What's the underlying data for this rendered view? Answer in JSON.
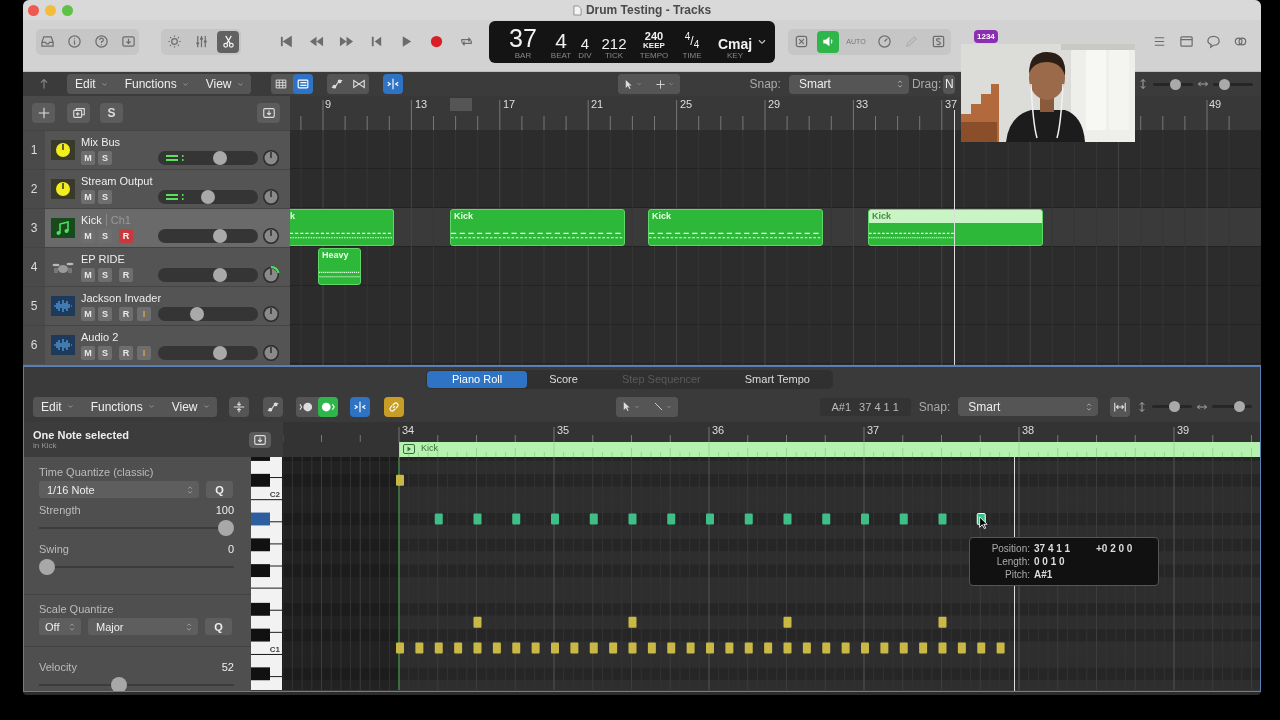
{
  "window": {
    "title": "Drum Testing - Tracks"
  },
  "control_bar": {
    "view_toggles": [
      {
        "on": false
      },
      {
        "on": false
      },
      {
        "on": true
      }
    ],
    "lcd": [
      {
        "value": "37",
        "label": "BAR"
      },
      {
        "value": "4",
        "label": "BEAT"
      },
      {
        "value": "4",
        "label": "DIV"
      },
      {
        "value": "212",
        "label": "TICK"
      },
      {
        "value": "240",
        "sub": "KEEP",
        "label": "TEMPO"
      },
      {
        "value": "$^{4}$/$_{4}$",
        "label": "TIME"
      },
      {
        "value": "Cmaj",
        "label": "KEY"
      }
    ],
    "monitor_toggles": [
      {
        "on": false
      },
      {
        "on": true
      }
    ],
    "auto_label": "AUTO",
    "badge": "1234"
  },
  "tracks_toolbar": {
    "menus": [
      "Edit",
      "Functions",
      "View"
    ],
    "view_toggles": [
      {
        "on": false
      },
      {
        "on": true
      }
    ],
    "catch": {
      "on": true
    },
    "snap_label": "Snap:",
    "snap": "Smart",
    "drag_label": "Drag:",
    "drag": "N",
    "zooms": [
      {
        "level": 0.6
      },
      {
        "level": 0.2
      }
    ]
  },
  "track_header_toolbar": {
    "solo_label": "S"
  },
  "ruler": [
    "9",
    "13",
    "17",
    "21",
    "25",
    "29",
    "33",
    "37",
    "49"
  ],
  "tracks": [
    {
      "number": "1",
      "name": "Mix Bus",
      "kind": "bus",
      "selected": false,
      "meter": true,
      "buttons": [
        {
          "label": "M",
          "kind": "mute",
          "on": false
        },
        {
          "label": "S",
          "kind": "solo",
          "on": false
        }
      ],
      "level": 0.64
    },
    {
      "number": "2",
      "name": "Stream Output",
      "kind": "bus",
      "selected": false,
      "meter": true,
      "buttons": [
        {
          "label": "M",
          "kind": "mute",
          "on": false
        },
        {
          "label": "S",
          "kind": "solo",
          "on": false
        }
      ],
      "level": 0.5
    },
    {
      "number": "3",
      "name": "Kick",
      "channel": "Ch1",
      "kind": "instrument",
      "selected": true,
      "buttons": [
        {
          "label": "M",
          "kind": "mute",
          "on": false
        },
        {
          "label": "S",
          "kind": "solo",
          "on": false
        },
        {
          "label": "R",
          "kind": "record",
          "on": true
        }
      ],
      "level": 0.64,
      "regions": [
        {
          "name": "k",
          "selected": false
        },
        {
          "name": "Kick",
          "selected": false
        },
        {
          "name": "Kick",
          "selected": false
        },
        {
          "name": "Kick",
          "selected": true
        }
      ]
    },
    {
      "number": "4",
      "name": "EP RIDE",
      "kind": "drums",
      "selected": false,
      "buttons": [
        {
          "label": "M",
          "kind": "mute",
          "on": false
        },
        {
          "label": "S",
          "kind": "solo",
          "on": false
        },
        {
          "label": "R",
          "kind": "record",
          "on": false
        }
      ],
      "level": 0.64,
      "regions": [
        {
          "name": "Heavy",
          "selected": false
        }
      ]
    },
    {
      "number": "5",
      "name": "Jackson Invader",
      "kind": "audio",
      "selected": false,
      "buttons": [
        {
          "label": "M",
          "kind": "mute",
          "on": false
        },
        {
          "label": "S",
          "kind": "solo",
          "on": false
        },
        {
          "label": "R",
          "kind": "record",
          "on": false
        },
        {
          "label": "I",
          "kind": "input",
          "on": false
        }
      ],
      "level": 0.37
    },
    {
      "number": "6",
      "name": "Audio 2",
      "kind": "audio",
      "selected": false,
      "buttons": [
        {
          "label": "M",
          "kind": "mute",
          "on": false
        },
        {
          "label": "S",
          "kind": "solo",
          "on": false
        },
        {
          "label": "R",
          "kind": "record",
          "on": false
        },
        {
          "label": "I",
          "kind": "input",
          "on": false
        }
      ],
      "level": 0.64
    }
  ],
  "editor": {
    "tabs": [
      {
        "label": "Piano Roll",
        "selected": true,
        "disabled": false
      },
      {
        "label": "Score",
        "selected": false,
        "disabled": false
      },
      {
        "label": "Step Sequencer",
        "selected": false,
        "disabled": true
      },
      {
        "label": "Smart Tempo",
        "selected": false,
        "disabled": false
      }
    ],
    "toolbar": {
      "menus": [
        "Edit",
        "Functions",
        "View"
      ],
      "midi_toggles": [
        {
          "on": false
        },
        {
          "on": true
        }
      ],
      "catch": {
        "on": true
      },
      "link": {
        "on": true
      },
      "pitch": "A#1",
      "position": "37 4 1 1",
      "snap_label": "Snap:",
      "snap": "Smart",
      "zooms": [
        {
          "level": 0.6
        },
        {
          "level": 0.75
        }
      ]
    },
    "inspector": {
      "title": "One Note selected",
      "subtitle": "in Kick",
      "time_quantize": {
        "title": "Time Quantize (classic)",
        "value": "1/16 Note",
        "button": "Q"
      },
      "sliders": [
        {
          "label": "Strength",
          "reading": "100",
          "level": 1
        },
        {
          "label": "Swing",
          "reading": "0",
          "level": 0
        }
      ],
      "scale_quantize": {
        "title": "Scale Quantize",
        "mode": "Off",
        "scale": "Major",
        "button": "Q"
      },
      "velocity": {
        "label": "Velocity",
        "reading": "52",
        "level": 0.4
      }
    },
    "keyboard_labels": [
      "C2",
      "C1"
    ],
    "ruler": [
      "34",
      "35",
      "36",
      "37",
      "38",
      "39"
    ],
    "region": "Kick",
    "tooltip": {
      "rows": [
        {
          "label": "Position:",
          "value": "37 4 1 1",
          "extra": "+0 2 0 0"
        },
        {
          "label": "Length:",
          "value": "0 0 1 0"
        },
        {
          "label": "Pitch:",
          "value": "A#1"
        }
      ]
    }
  }
}
